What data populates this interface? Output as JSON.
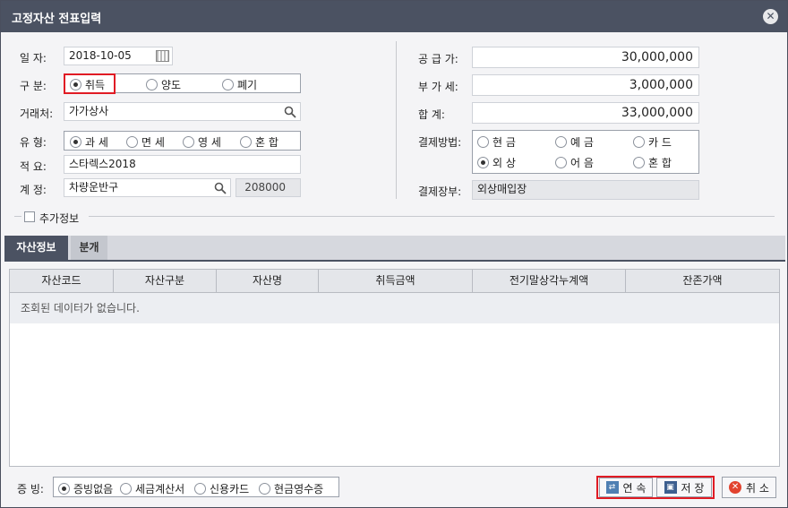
{
  "window": {
    "title": "고정자산 전표입력",
    "close": "✕"
  },
  "left": {
    "date_label": "일    자:",
    "date_value": "2018-10-05",
    "type_label": "구    분:",
    "type_options": [
      "취득",
      "양도",
      "폐기"
    ],
    "vendor_label": "거래처:",
    "vendor_value": "가가상사",
    "kind_label": "유    형:",
    "kind_options": [
      "과 세",
      "면 세",
      "영 세",
      "혼 합"
    ],
    "memo_label": "적    요:",
    "memo_value": "스타렉스2018",
    "account_label": "계    정:",
    "account_value": "차량운반구",
    "account_code": "208000"
  },
  "right": {
    "supply_label": "공  급  가:",
    "supply_value": "30,000,000",
    "vat_label": "부  가  세:",
    "vat_value": "3,000,000",
    "total_label": "합       계:",
    "total_value": "33,000,000",
    "payment_label": "결제방법:",
    "payment_options": [
      "현 금",
      "예 금",
      "카 드",
      "외 상",
      "어 음",
      "혼 합"
    ],
    "ledger_label": "결제장부:",
    "ledger_value": "외상매입장"
  },
  "extra": {
    "label": "추가정보"
  },
  "tabs": [
    "자산정보",
    "분개"
  ],
  "grid": {
    "columns": [
      "자산코드",
      "자산구분",
      "자산명",
      "취득금액",
      "전기말상각누계액",
      "잔존가액"
    ],
    "empty_text": "조회된 데이터가 없습니다."
  },
  "footer": {
    "proof_label": "증  빙:",
    "proof_options": [
      "증빙없음",
      "세금계산서",
      "신용카드",
      "현금영수증"
    ],
    "continue_label": "연 속",
    "save_label": "저 장",
    "cancel_label": "취 소"
  },
  "colors": {
    "titlebar": "#4b5262",
    "highlight": "#e01b24"
  }
}
